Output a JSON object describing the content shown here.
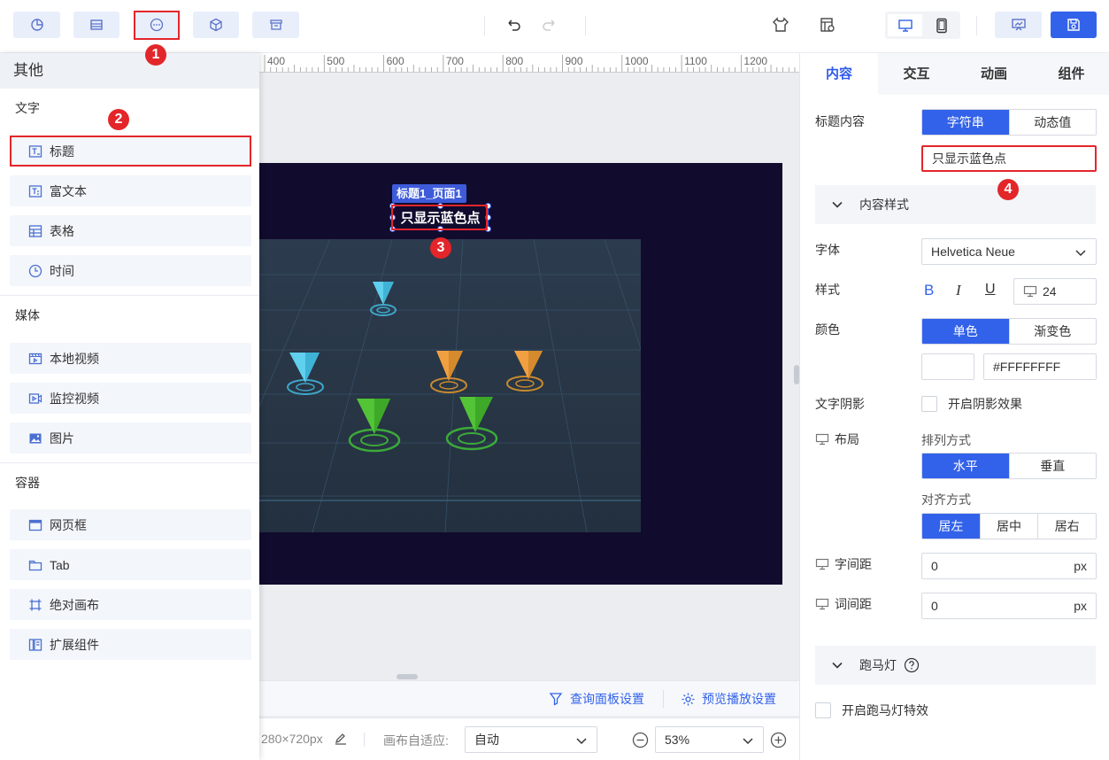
{
  "toolbar": {
    "left_icons": [
      "chart-icon",
      "table-icon",
      "more-icon",
      "cube-icon",
      "archive-icon"
    ],
    "right_icons": [
      "theme-icon",
      "settings-icon",
      "desktop-icon",
      "mobile-icon",
      "preview-icon",
      "save-icon"
    ]
  },
  "markers": [
    "1",
    "2",
    "3",
    "4"
  ],
  "left_panel": {
    "title": "其他",
    "sections": [
      {
        "title": "文字",
        "items": [
          "标题",
          "富文本",
          "表格",
          "时间"
        ]
      },
      {
        "title": "媒体",
        "items": [
          "本地视频",
          "监控视频",
          "图片"
        ]
      },
      {
        "title": "容器",
        "items": [
          "网页框",
          "Tab",
          "绝对画布",
          "扩展组件"
        ]
      }
    ]
  },
  "ruler": {
    "ticks": [
      "400",
      "500",
      "600",
      "700",
      "800",
      "900",
      "1000",
      "1100",
      "1200"
    ]
  },
  "canvas": {
    "component_tag": "标题1_页面1",
    "title_text": "只显示蓝色点"
  },
  "bottom": {
    "query_settings": "查询面板设置",
    "preview_settings": "预览播放设置",
    "size_text": "280×720px",
    "adapt_label": "画布自适应:",
    "adapt_value": "自动",
    "zoom_value": "53%"
  },
  "right_panel": {
    "tabs": [
      "内容",
      "交互",
      "动画",
      "组件"
    ],
    "title_content_label": "标题内容",
    "title_mode_options": [
      "字符串",
      "动态值"
    ],
    "title_value": "只显示蓝色点",
    "content_style_label": "内容样式",
    "font_label": "字体",
    "font_value": "Helvetica Neue",
    "style_label": "样式",
    "style_buttons": [
      "B",
      "I",
      "U"
    ],
    "font_size": "24",
    "color_label": "颜色",
    "color_mode_options": [
      "单色",
      "渐变色"
    ],
    "color_value": "#FFFFFFFF",
    "text_shadow_label": "文字阴影",
    "text_shadow_option": "开启阴影效果",
    "layout_label": "布局",
    "arrange_label": "排列方式",
    "arrange_options": [
      "水平",
      "垂直"
    ],
    "align_label": "对齐方式",
    "align_options": [
      "居左",
      "居中",
      "居右"
    ],
    "letter_spacing_label": "字间距",
    "letter_spacing_value": "0",
    "word_spacing_label": "词间距",
    "word_spacing_value": "0",
    "unit": "px",
    "marquee_label": "跑马灯",
    "marquee_option": "开启跑马灯特效"
  },
  "colors": {
    "accent": "#3362ea",
    "marker": "#e3262a",
    "stage": "#110b2d"
  }
}
